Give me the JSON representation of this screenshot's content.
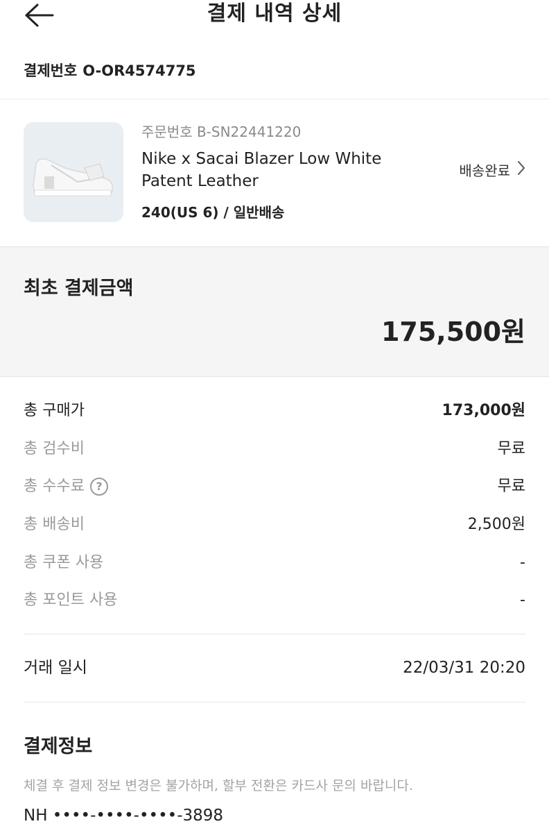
{
  "header": {
    "title": "결제 내역 상세",
    "back_icon": "arrow-left-icon"
  },
  "payment": {
    "label": "결제번호",
    "number": "O-OR4574775"
  },
  "product": {
    "order_no": "주문번호 B-SN22441220",
    "name": "Nike x Sacai Blazer Low White Patent Leather",
    "option": "240(US 6) / 일반배송",
    "status": "배송완료",
    "status_icon": "chevron-right-icon",
    "thumb_icon": "sneaker-image"
  },
  "summary": {
    "label": "최초 결제금액",
    "amount": "175,500원"
  },
  "breakdown": [
    {
      "label": "총 구매가",
      "value": "173,000원"
    },
    {
      "label": "총 검수비",
      "value": "무료"
    },
    {
      "label": "총 수수료",
      "value": "무료",
      "help": "?"
    },
    {
      "label": "총 배송비",
      "value": "2,500원"
    },
    {
      "label": "총 쿠폰 사용",
      "value": "-"
    },
    {
      "label": "총 포인트 사용",
      "value": "-"
    }
  ],
  "transaction": {
    "label": "거래 일시",
    "value": "22/03/31 20:20"
  },
  "payment_info": {
    "title": "결제정보",
    "note": "체결 후 결제 정보 변경은 불가하며, 할부 전환은 카드사 문의 바랍니다.",
    "card": "NH ••••-••••-••••-3898"
  },
  "colors": {
    "text": "#222222",
    "muted": "#9a9a9a",
    "summary_bg": "#f5f5f5",
    "thumb_bg": "#e9eef3"
  }
}
